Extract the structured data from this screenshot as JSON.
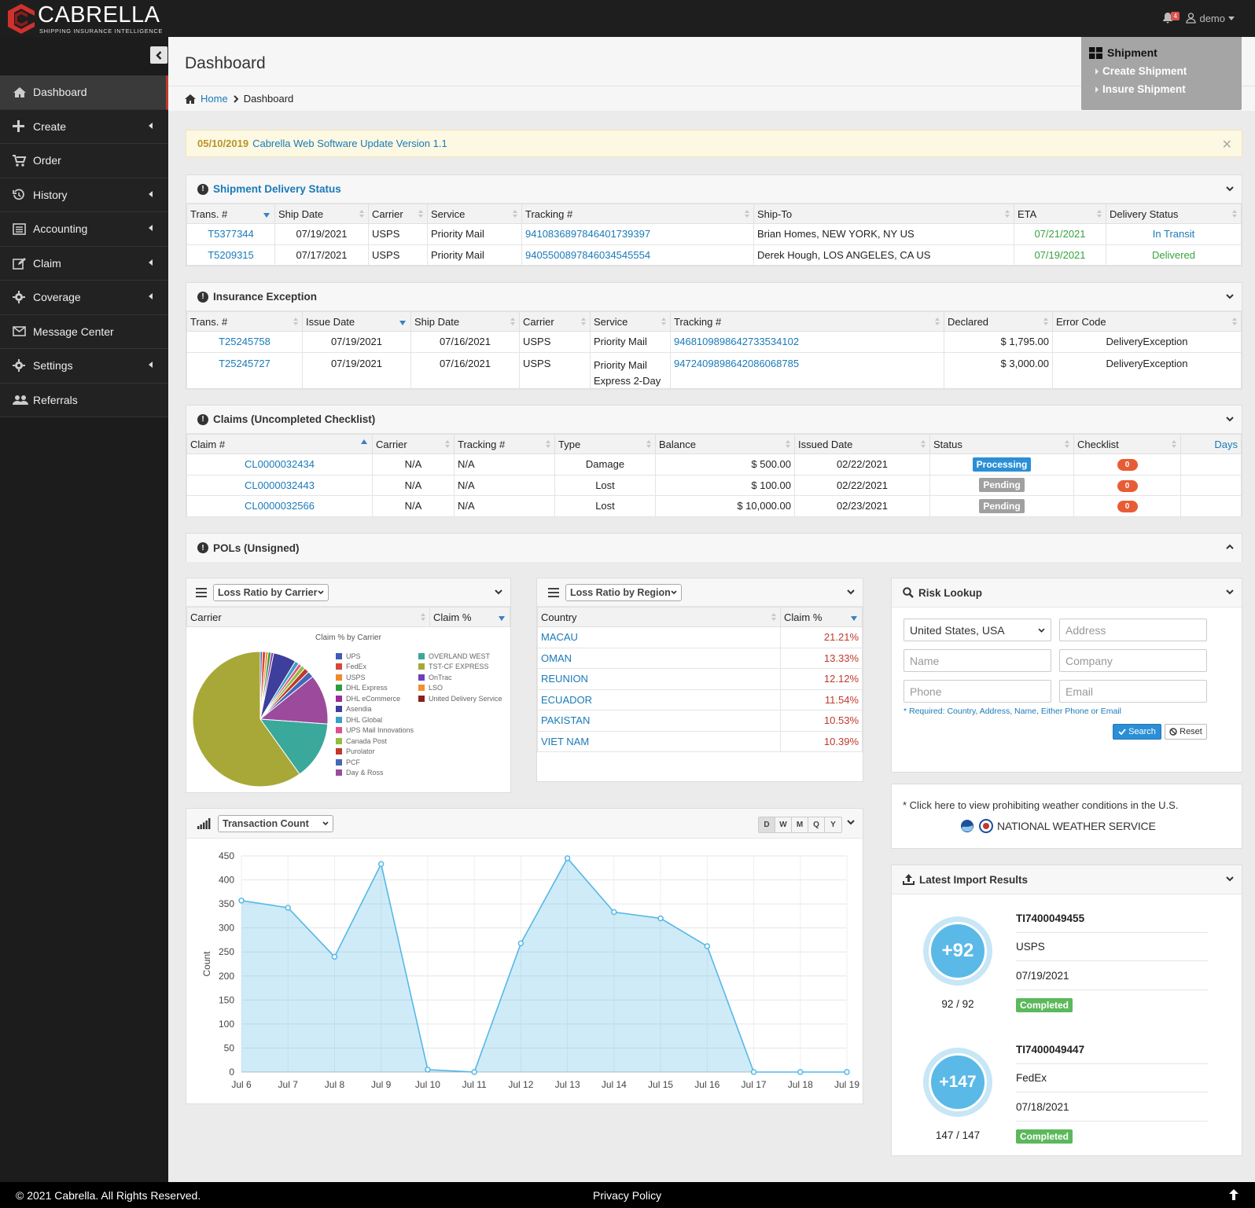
{
  "brand": {
    "name": "CABRELLA",
    "tagline": "SHIPPING INSURANCE INTELLIGENCE"
  },
  "topbar": {
    "notification_count": "4",
    "user": "demo"
  },
  "sidebar": {
    "items": [
      {
        "label": "Dashboard",
        "icon": "home-icon"
      },
      {
        "label": "Create",
        "icon": "plus-icon"
      },
      {
        "label": "Order",
        "icon": "cart-icon"
      },
      {
        "label": "History",
        "icon": "history-icon"
      },
      {
        "label": "Accounting",
        "icon": "list-icon"
      },
      {
        "label": "Claim",
        "icon": "edit-icon"
      },
      {
        "label": "Coverage",
        "icon": "gear-icon"
      },
      {
        "label": "Message Center",
        "icon": "envelope-icon"
      },
      {
        "label": "Settings",
        "icon": "gear-icon"
      },
      {
        "label": "Referrals",
        "icon": "users-icon"
      }
    ]
  },
  "page": {
    "title": "Dashboard",
    "breadcrumb": {
      "home": "Home",
      "current": "Dashboard"
    }
  },
  "shipment_menu": {
    "title": "Shipment",
    "items": [
      "Create Shipment",
      "Insure Shipment"
    ]
  },
  "alert": {
    "date": "05/10/2019",
    "text": "Cabrella Web Software Update Version 1.1"
  },
  "delivery": {
    "title": "Shipment Delivery Status",
    "columns": [
      "Trans. #",
      "Ship Date",
      "Carrier",
      "Service",
      "Tracking #",
      "Ship-To",
      "ETA",
      "Delivery Status"
    ],
    "rows": [
      [
        "T5377344",
        "07/19/2021",
        "USPS",
        "Priority Mail",
        "9410836897846401739397",
        "Brian Homes, NEW YORK, NY US",
        "07/21/2021",
        "In Transit"
      ],
      [
        "T5209315",
        "07/17/2021",
        "USPS",
        "Priority Mail",
        "9405500897846034545554",
        "Derek Hough, LOS ANGELES, CA US",
        "07/19/2021",
        "Delivered"
      ]
    ]
  },
  "exception": {
    "title": "Insurance Exception",
    "columns": [
      "Trans. #",
      "Issue Date",
      "Ship Date",
      "Carrier",
      "Service",
      "Tracking #",
      "Declared",
      "Error Code"
    ],
    "rows": [
      [
        "T25245758",
        "07/19/2021",
        "07/16/2021",
        "USPS",
        "Priority Mail",
        "9468109898642733534102",
        "$ 1,795.00",
        "DeliveryException"
      ],
      [
        "T25245727",
        "07/19/2021",
        "07/16/2021",
        "USPS",
        "Priority Mail Express 2-Day",
        "9472409898642086068785",
        "$ 3,000.00",
        "DeliveryException"
      ]
    ]
  },
  "claims": {
    "title": "Claims (Uncompleted Checklist)",
    "columns": [
      "Claim #",
      "Carrier",
      "Tracking #",
      "Type",
      "Balance",
      "Issued Date",
      "Status",
      "Checklist",
      "Days"
    ],
    "rows": [
      [
        "CL0000032434",
        "N/A",
        "N/A",
        "Damage",
        "$ 500.00",
        "02/22/2021",
        "Processing",
        "0",
        ""
      ],
      [
        "CL0000032443",
        "N/A",
        "N/A",
        "Lost",
        "$ 100.00",
        "02/22/2021",
        "Pending",
        "0",
        ""
      ],
      [
        "CL0000032566",
        "N/A",
        "N/A",
        "Lost",
        "$ 10,000.00",
        "02/23/2021",
        "Pending",
        "0",
        ""
      ]
    ]
  },
  "pols": {
    "title": "POLs (Unsigned)"
  },
  "carrier_panel": {
    "select": "Loss Ratio by Carrier",
    "columns": [
      "Carrier",
      "Claim %"
    ],
    "pie_title": "Claim % by Carrier",
    "legend_left": [
      {
        "name": "UPS",
        "color": "#3d5bb8"
      },
      {
        "name": "FedEx",
        "color": "#d9473a"
      },
      {
        "name": "USPS",
        "color": "#f08a2a"
      },
      {
        "name": "DHL Express",
        "color": "#2e9b3f"
      },
      {
        "name": "DHL eCommerce",
        "color": "#962d9c"
      },
      {
        "name": "Asendia",
        "color": "#3e3e9c"
      },
      {
        "name": "DHL Global",
        "color": "#3aa0c4"
      },
      {
        "name": "UPS Mail Innovations",
        "color": "#e0508a"
      },
      {
        "name": "Canada Post",
        "color": "#8fbf3c"
      },
      {
        "name": "Purolator",
        "color": "#c0392b"
      },
      {
        "name": "PCF",
        "color": "#4467b8"
      },
      {
        "name": "Day & Ross",
        "color": "#9c4a9c"
      }
    ],
    "legend_right": [
      {
        "name": "OVERLAND WEST",
        "color": "#3aa89a"
      },
      {
        "name": "TST-CF EXPRESS",
        "color": "#a8a838"
      },
      {
        "name": "OnTrac",
        "color": "#6a3fc4"
      },
      {
        "name": "LSO",
        "color": "#f09030"
      },
      {
        "name": "United Delivery Service",
        "color": "#8a2020"
      }
    ],
    "slices": [
      {
        "value": 0.5,
        "color": "#3d5bb8"
      },
      {
        "value": 0.8,
        "color": "#d9473a"
      },
      {
        "value": 0.6,
        "color": "#f08a2a"
      },
      {
        "value": 0.7,
        "color": "#2e9b3f"
      },
      {
        "value": 0.6,
        "color": "#962d9c"
      },
      {
        "value": 5.5,
        "color": "#3e3e9c"
      },
      {
        "value": 1.0,
        "color": "#3aa0c4"
      },
      {
        "value": 0.8,
        "color": "#e0508a"
      },
      {
        "value": 1.0,
        "color": "#8fbf3c"
      },
      {
        "value": 1.2,
        "color": "#c0392b"
      },
      {
        "value": 1.5,
        "color": "#4467b8"
      },
      {
        "value": 12,
        "color": "#9c4a9c"
      },
      {
        "value": 14,
        "color": "#3aa89a"
      },
      {
        "value": 60,
        "color": "#a8a838"
      }
    ]
  },
  "region_panel": {
    "select": "Loss Ratio by Region",
    "columns": [
      "Country",
      "Claim %"
    ],
    "rows": [
      [
        "MACAU",
        "21.21%"
      ],
      [
        "OMAN",
        "13.33%"
      ],
      [
        "REUNION",
        "12.12%"
      ],
      [
        "ECUADOR",
        "11.54%"
      ],
      [
        "PAKISTAN",
        "10.53%"
      ],
      [
        "VIET NAM",
        "10.39%"
      ]
    ]
  },
  "risk": {
    "title": "Risk Lookup",
    "country": "United States, USA",
    "placeholders": {
      "address": "Address",
      "name": "Name",
      "company": "Company",
      "phone": "Phone",
      "email": "Email"
    },
    "note": "* Required: Country, Address, Name, Either Phone or Email",
    "search": "Search",
    "reset": "Reset"
  },
  "weather": {
    "text": "* Click here to view prohibiting weather conditions in the U.S.",
    "logo": "NATIONAL WEATHER SERVICE"
  },
  "imports": {
    "title": "Latest Import Results",
    "items": [
      {
        "count": "+92",
        "ratio": "92 / 92",
        "id": "TI7400049455",
        "carrier": "USPS",
        "date": "07/19/2021",
        "status": "Completed"
      },
      {
        "count": "+147",
        "ratio": "147 / 147",
        "id": "TI7400049447",
        "carrier": "FedEx",
        "date": "07/18/2021",
        "status": "Completed"
      }
    ]
  },
  "transactions": {
    "select": "Transaction Count",
    "periods": [
      "D",
      "W",
      "M",
      "Q",
      "Y"
    ]
  },
  "chart_data": {
    "type": "area",
    "ylabel": "Count",
    "ylim": [
      0,
      450
    ],
    "yticks": [
      0,
      50,
      100,
      150,
      200,
      250,
      300,
      350,
      400,
      450
    ],
    "categories": [
      "Jul 6",
      "Jul 7",
      "Jul 8",
      "Jul 9",
      "Jul 10",
      "Jul 11",
      "Jul 12",
      "Jul 13",
      "Jul 14",
      "Jul 15",
      "Jul 16",
      "Jul 17",
      "Jul 18",
      "Jul 19"
    ],
    "points": [
      {
        "x": "Jul 6",
        "y": 357
      },
      {
        "x": "Jul 7",
        "y": 342
      },
      {
        "x": "Jul 8",
        "y": 240
      },
      {
        "x": "Jul 9",
        "y": 433
      },
      {
        "x": "Jul 10",
        "y": 5
      },
      {
        "x": "Jul 11",
        "y": 0
      },
      {
        "x": "Jul 12",
        "y": 268
      },
      {
        "x": "Jul 13",
        "y": 445
      },
      {
        "x": "Jul 14",
        "y": 333
      },
      {
        "x": "Jul 15",
        "y": 320
      },
      {
        "x": "Jul 16",
        "y": 262
      },
      {
        "x": "Jul 17",
        "y": 0
      },
      {
        "x": "Jul 18",
        "y": 0
      },
      {
        "x": "Jul 19",
        "y": 0
      }
    ],
    "grid": true,
    "color": "#55b8e6"
  },
  "footer": {
    "copyright": "© 2021 Cabrella. All Rights Reserved.",
    "privacy": "Privacy Policy"
  }
}
